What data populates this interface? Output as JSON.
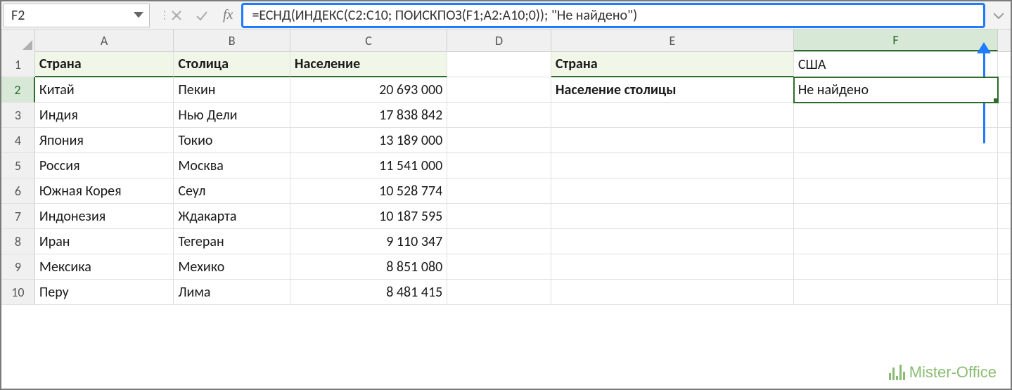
{
  "nameBox": "F2",
  "fxLabel": "fx",
  "formula": "=ЕСНД(ИНДЕКС(C2:C10; ПОИСКПОЗ(F1;A2:A10;0)); \"Не найдено\")",
  "columns": [
    "A",
    "B",
    "C",
    "D",
    "E",
    "F"
  ],
  "rowNums": [
    "1",
    "2",
    "3",
    "4",
    "5",
    "6",
    "7",
    "8",
    "9",
    "10"
  ],
  "headers": {
    "country": "Страна",
    "capital": "Столица",
    "population": "Население",
    "lookupCountry": "Страна",
    "lookupPopCapital": "Население столицы"
  },
  "data": [
    {
      "country": "Китай",
      "capital": "Пекин",
      "population": "20 693 000"
    },
    {
      "country": "Индия",
      "capital": "Нью Дели",
      "population": "17 838 842"
    },
    {
      "country": "Япония",
      "capital": "Токио",
      "population": "13 189 000"
    },
    {
      "country": "Россия",
      "capital": "Москва",
      "population": "11 541 000"
    },
    {
      "country": "Южная Корея",
      "capital": "Сеул",
      "population": "10 528 774"
    },
    {
      "country": "Индонезия",
      "capital": "Ждакарта",
      "population": "10 187 595"
    },
    {
      "country": "Иран",
      "capital": "Тегеран",
      "population": "9 110 347"
    },
    {
      "country": "Мексика",
      "capital": "Мехико",
      "population": "8 851 080"
    },
    {
      "country": "Перу",
      "capital": "Лима",
      "population": "8 481 415"
    }
  ],
  "lookup": {
    "input": "США",
    "result": "Не найдено"
  },
  "watermark": "Mister-Office"
}
